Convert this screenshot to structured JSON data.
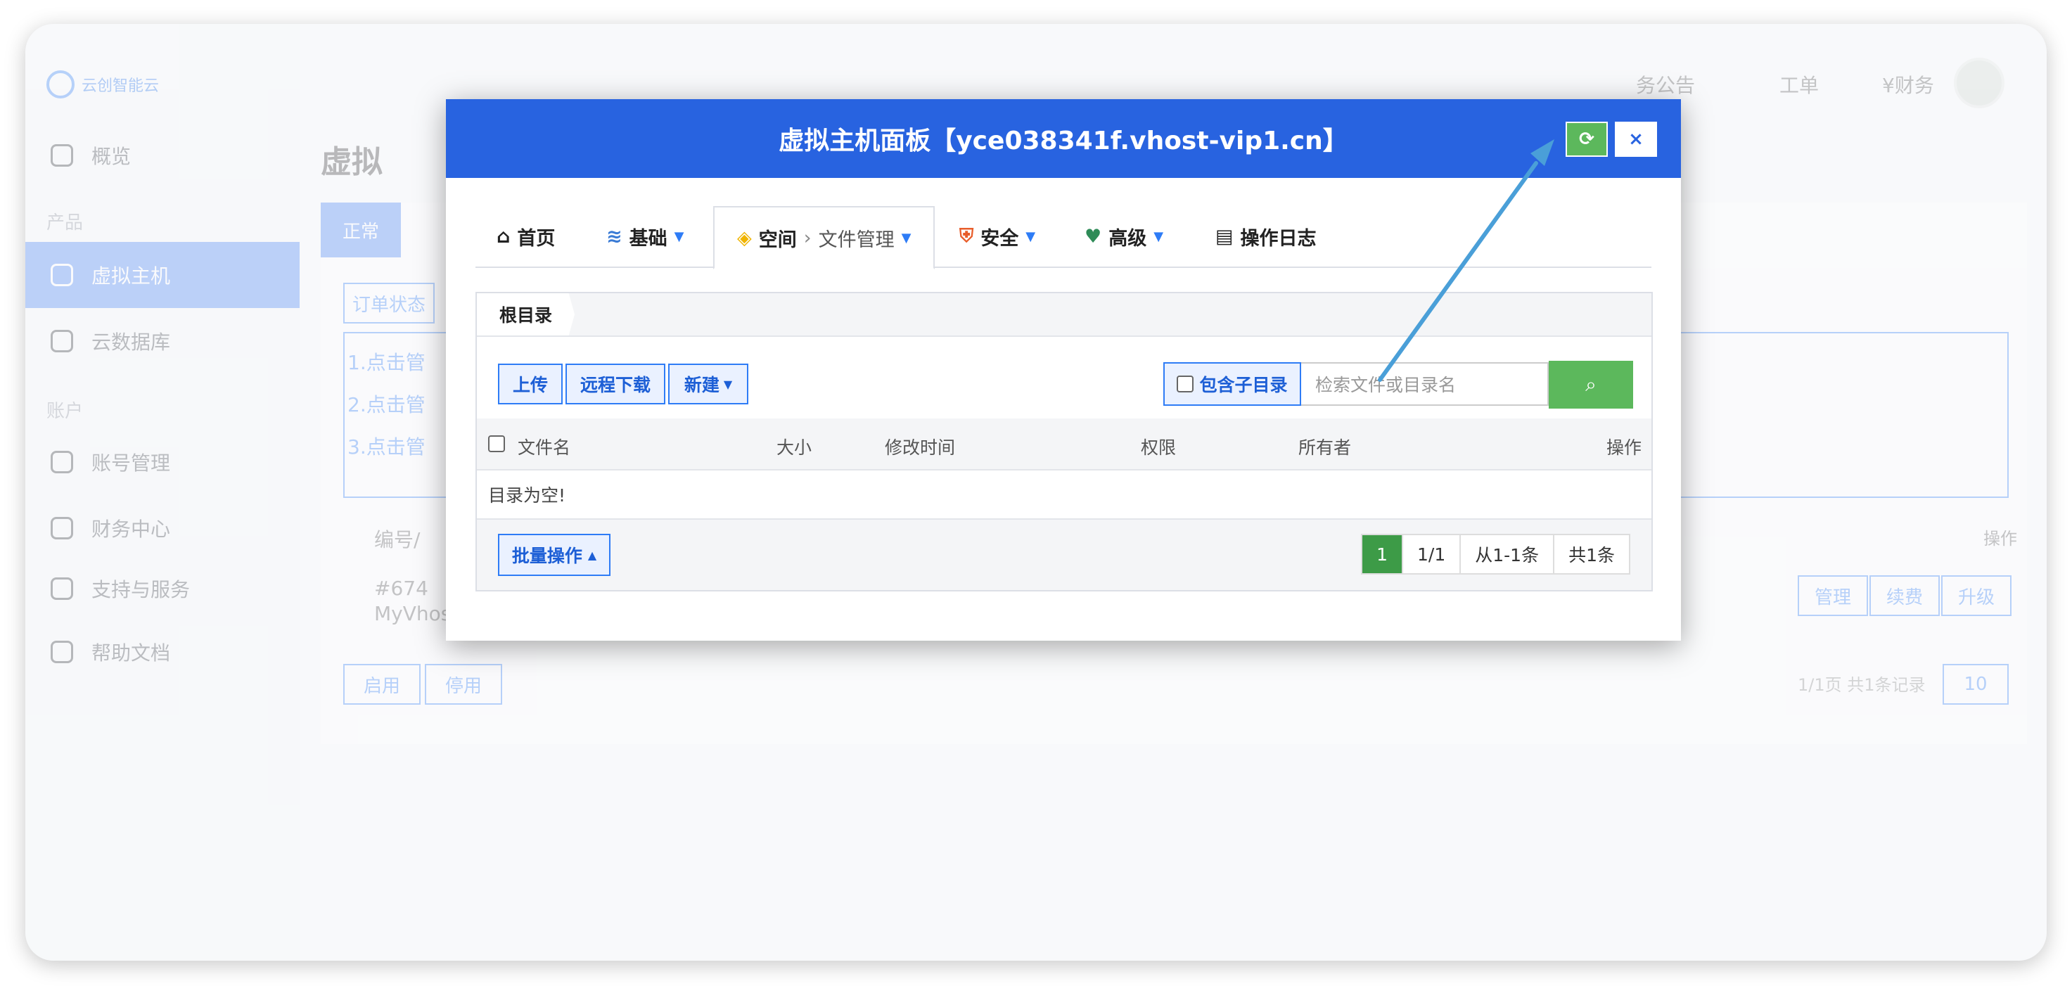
{
  "app": {
    "logo": "云创智能云",
    "sidebar": {
      "overview": "概览",
      "group_products": "产品",
      "items": [
        "虚拟主机",
        "云数据库"
      ],
      "group_account": "账户",
      "account_items": [
        "账号管理",
        "财务中心",
        "支持与服务",
        "帮助文档"
      ]
    },
    "topbar": {
      "notice": "务公告",
      "ticket": "工单",
      "finance": "¥财务"
    },
    "page_title": "虚拟",
    "tab_normal": "正常",
    "order_status": "订单状态",
    "hints": [
      "1.点击管",
      "2.点击管",
      "3.点击管"
    ],
    "row_id": "#674",
    "row_name": "MyVhost",
    "col_id": "编号/",
    "row_actions": [
      "管理",
      "续费",
      "升级"
    ],
    "col_actions": "操作",
    "enable": "启用",
    "disable": "停用",
    "pagination": "1/1页 共1条记录",
    "per_page": "10"
  },
  "modal": {
    "title": "虚拟主机面板【yce038341f.vhost-vip1.cn】",
    "refresh_icon": "refresh-icon",
    "close_label": "×",
    "tabs": {
      "home": "首页",
      "basic": "基础",
      "space": "空间",
      "space_sub": "文件管理",
      "security": "安全",
      "advanced": "高级",
      "log": "操作日志"
    },
    "breadcrumb": "根目录",
    "toolbar": {
      "upload": "上传",
      "remote_download": "远程下载",
      "new": "新建"
    },
    "search": {
      "include_sub": "包含子目录",
      "placeholder": "检索文件或目录名"
    },
    "table": {
      "headers": [
        "文件名",
        "大小",
        "修改时间",
        "权限",
        "所有者",
        "操作"
      ],
      "empty": "目录为空!"
    },
    "footer": {
      "batch": "批量操作",
      "pages": [
        "1",
        "1/1",
        "从1-1条",
        "共1条"
      ]
    }
  },
  "colors": {
    "primary": "#2863e0",
    "success": "#5cb85c",
    "arrow": "#4a9fd8"
  }
}
